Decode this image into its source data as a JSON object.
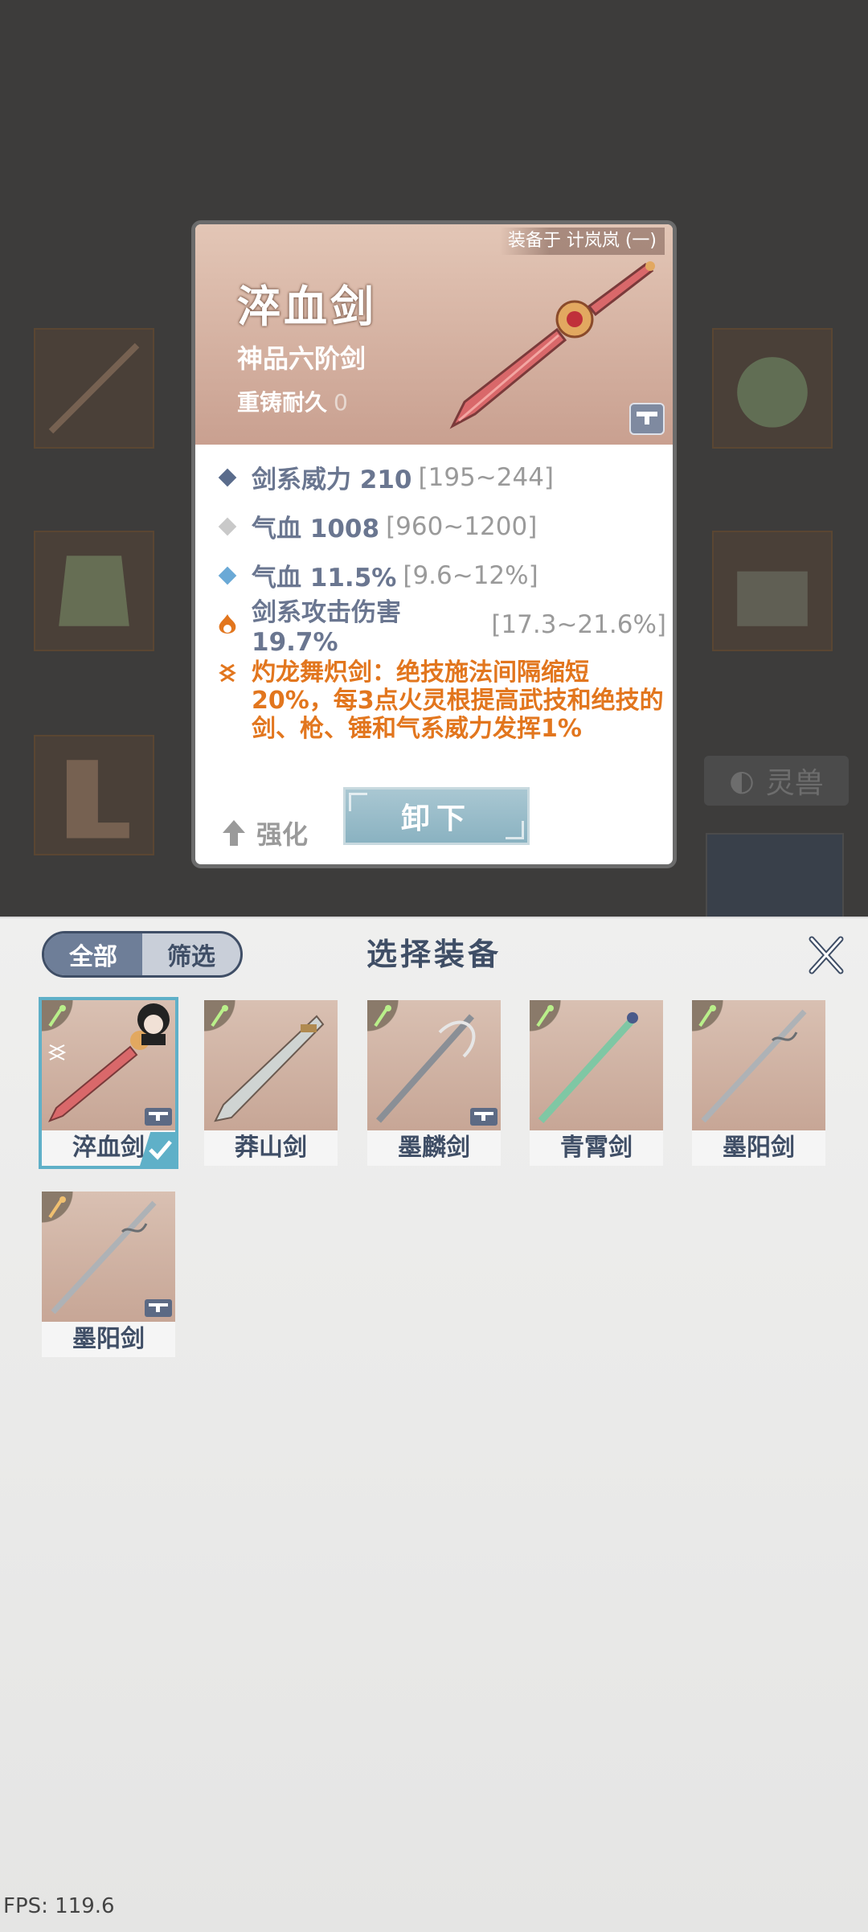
{
  "background": {
    "spirit_beast_tab": "灵兽"
  },
  "detail": {
    "equipped_by": "装备于 计岚岚 (一)",
    "name": "淬血剑",
    "grade": "神品六阶剑",
    "recast_label": "重铸耐久",
    "recast_value": "0",
    "stats": [
      {
        "label": "剑系威力 210",
        "range": "[195~244]",
        "bullet_color": "#5a6c8c",
        "bullet": "diamond"
      },
      {
        "label": "气血 1008",
        "range": "[960~1200]",
        "bullet_color": "#c9c9c9",
        "bullet": "diamond"
      },
      {
        "label": "气血 11.5%",
        "range": "[9.6~12%]",
        "bullet_color": "#6aa9d6",
        "bullet": "diamond"
      },
      {
        "label": "剑系攻击伤害 19.7%",
        "range": "[17.3~21.6%]",
        "bullet_color": "#e2761e",
        "bullet": "flame-icon"
      }
    ],
    "skill": "灼龙舞炽剑：绝技施法间隔缩短20%，每3点火灵根提高武技和绝技的剑、枪、锤和气系威力发挥1%",
    "enhance_label": "强化",
    "unequip_label": "卸下"
  },
  "sheet": {
    "title": "选择装备",
    "filter_all": "全部",
    "filter_select": "筛选",
    "items": [
      {
        "name": "淬血剑",
        "blade": "#d9686a",
        "corner": "green",
        "selected": true,
        "equipped": true,
        "chest": true
      },
      {
        "name": "莽山剑",
        "blade": "#cfd4d2",
        "corner": "green",
        "selected": false,
        "equipped": false,
        "chest": false
      },
      {
        "name": "墨麟剑",
        "blade": "#8a8f96",
        "corner": "green",
        "selected": false,
        "equipped": false,
        "chest": true
      },
      {
        "name": "青霄剑",
        "blade": "#7fc7a4",
        "corner": "green",
        "selected": false,
        "equipped": false,
        "chest": false
      },
      {
        "name": "墨阳剑",
        "blade": "#aeb2b6",
        "corner": "green",
        "selected": false,
        "equipped": false,
        "chest": false
      },
      {
        "name": "墨阳剑",
        "blade": "#aeb2b6",
        "corner": "gold",
        "selected": false,
        "equipped": false,
        "chest": true
      }
    ]
  },
  "fps": "FPS: 119.6"
}
